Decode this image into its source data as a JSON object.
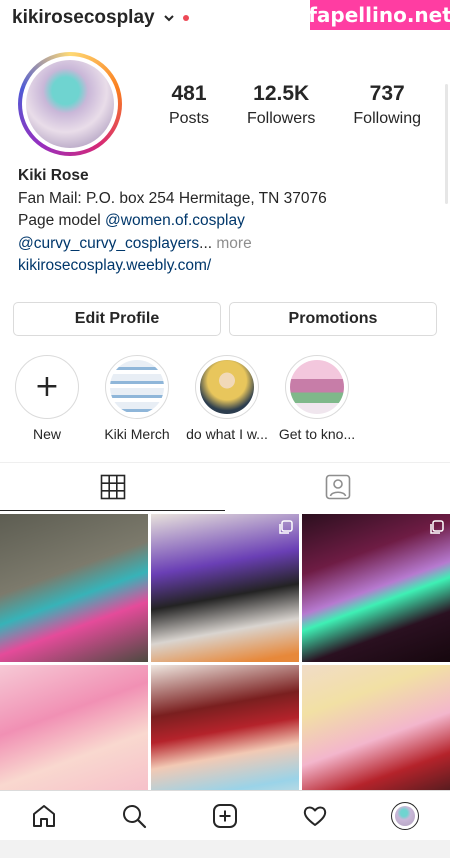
{
  "header": {
    "username": "kikirosecosplay",
    "watermark": "fapellino.net"
  },
  "stats": [
    {
      "value": "481",
      "label": "Posts"
    },
    {
      "value": "12.5K",
      "label": "Followers"
    },
    {
      "value": "737",
      "label": "Following"
    }
  ],
  "bio": {
    "name": "Kiki Rose",
    "line1": "Fan Mail: P.O. box 254 Hermitage, TN 37076",
    "line2_prefix": "Page model ",
    "line2_link": "@women.of.cosplay",
    "line3_link": "@curvy_curvy_cosplayers",
    "line3_ellipsis": "...",
    "line3_more": " more",
    "website": "kikirosecosplay.weebly.com/"
  },
  "buttons": {
    "edit_profile": "Edit Profile",
    "promotions": "Promotions"
  },
  "highlights": [
    {
      "label": "New"
    },
    {
      "label": "Kiki Merch"
    },
    {
      "label": "do what I w..."
    },
    {
      "label": "Get to kno..."
    }
  ],
  "tabs": {
    "grid_icon": "grid-icon",
    "tagged_icon": "tagged-person-icon"
  },
  "nav": {
    "home": "home-icon",
    "search": "search-icon",
    "create": "add-post-icon",
    "activity": "heart-icon",
    "profile": "profile-avatar"
  },
  "colors": {
    "accent_link": "#00376b",
    "notification_dot": "#ed4956",
    "watermark_bg": "#ff3da2"
  }
}
